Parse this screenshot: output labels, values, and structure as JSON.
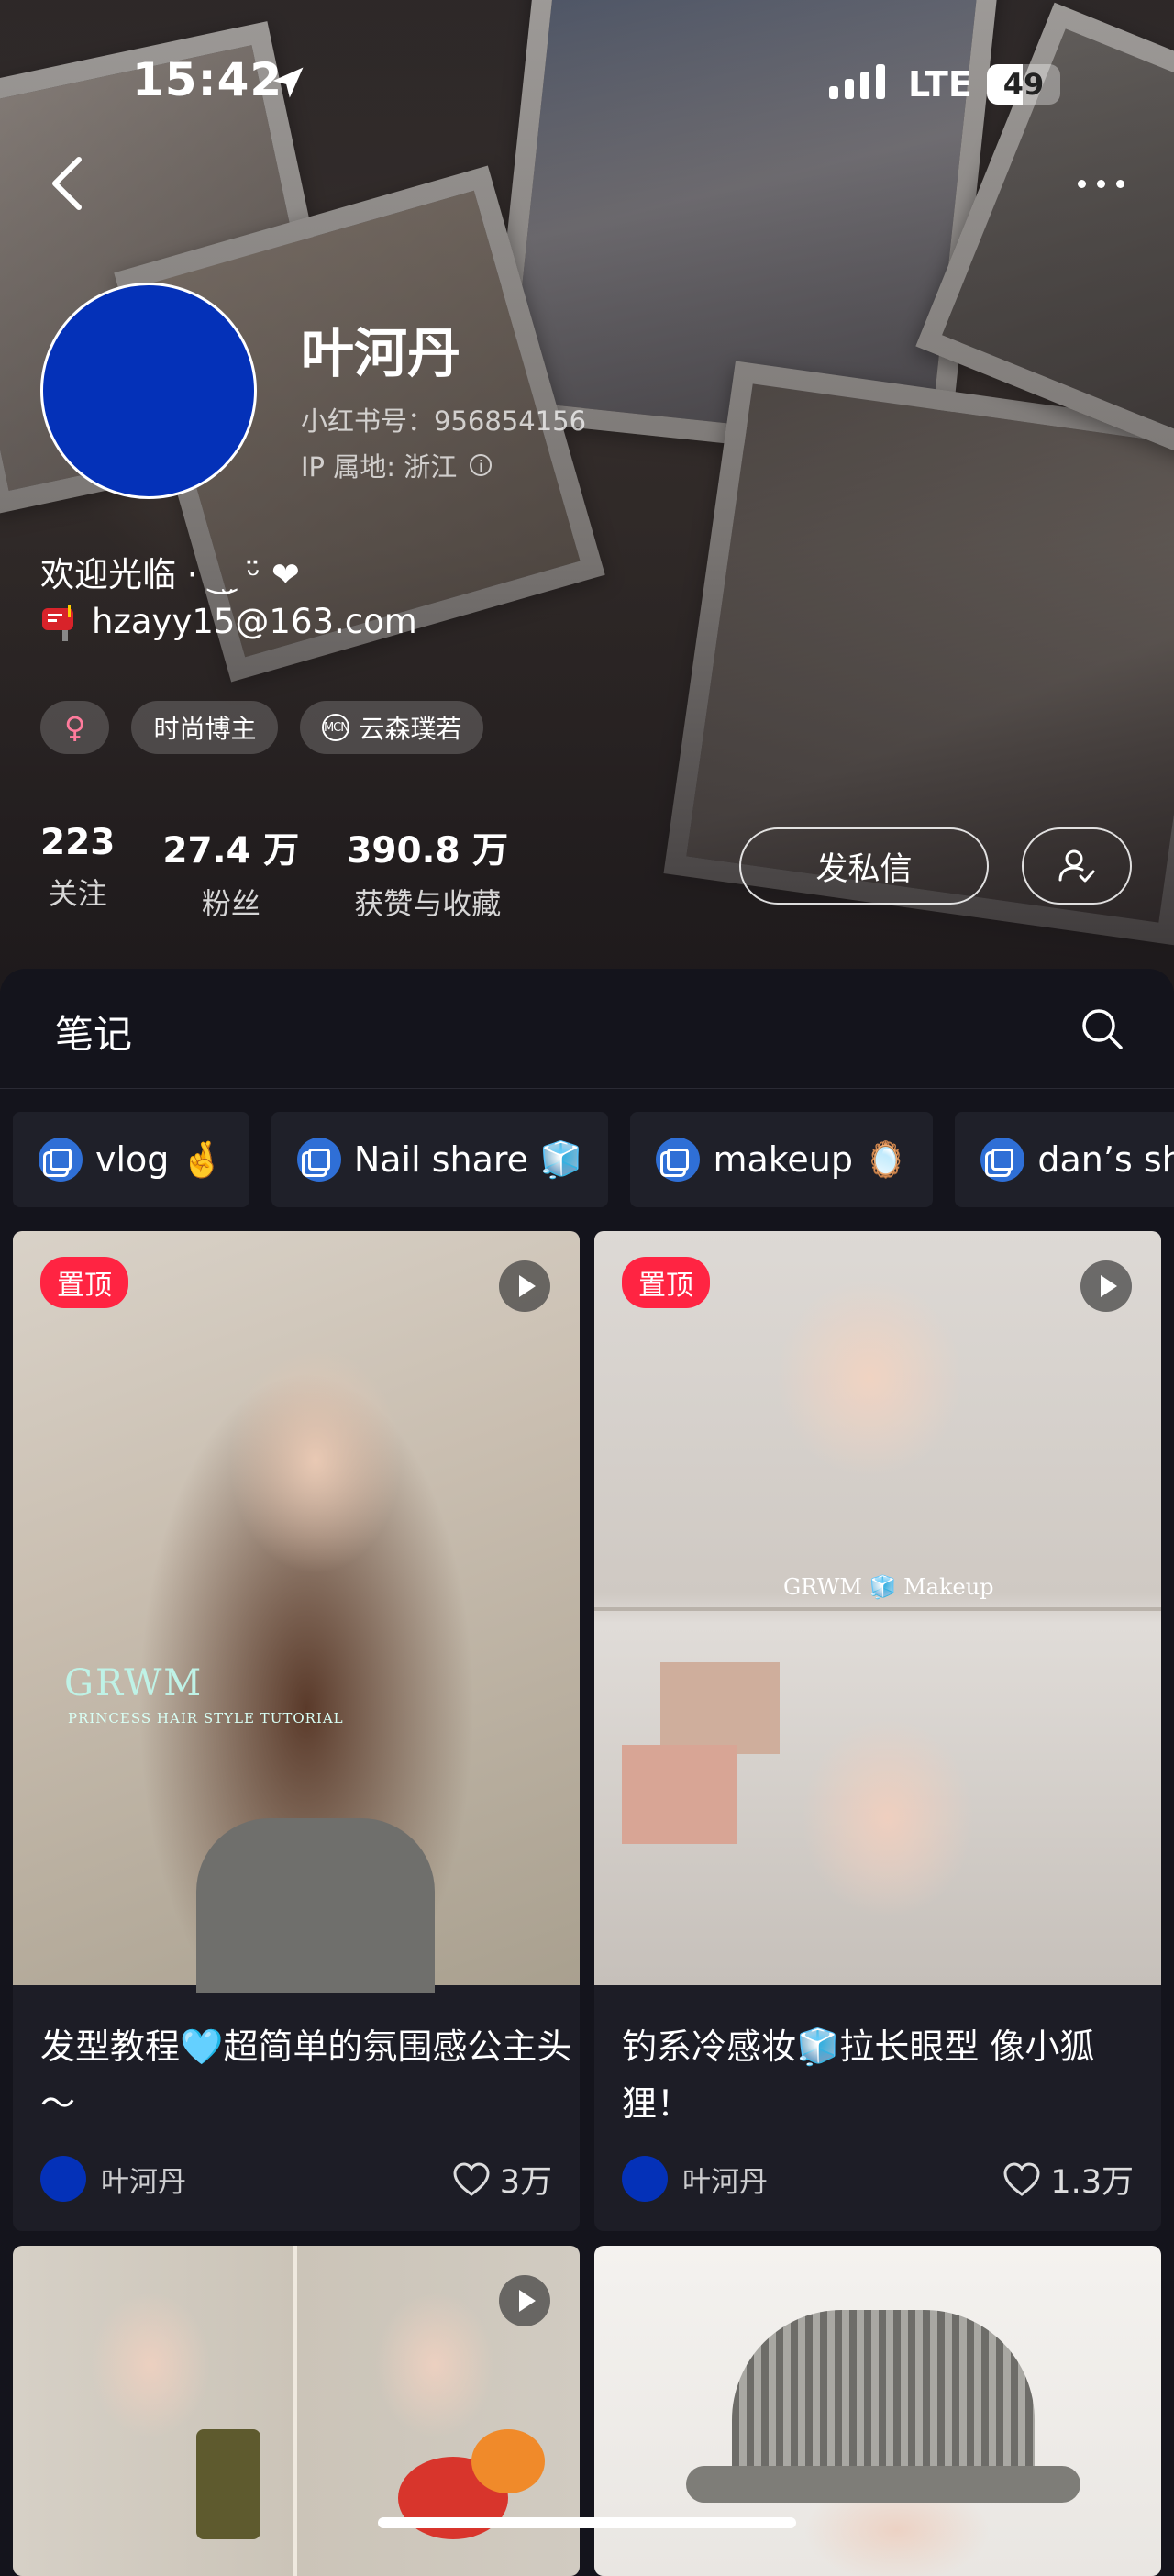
{
  "status_bar": {
    "time": "15:42",
    "network": "LTE",
    "battery": "49",
    "battery_level": 0.49
  },
  "profile": {
    "name": "叶河丹",
    "red_id": "小红书号：956854156",
    "ip_location": "IP 属地: 浙江",
    "avatar_color": "#0431b8",
    "bio_line1": "欢迎光临 · ‿̮ ᵕ̈ ❤",
    "bio_email": "hzayy15@163.com",
    "tags": [
      "♀",
      "时尚博主",
      "云森璞若"
    ],
    "mcn_label": "MCN"
  },
  "stats": [
    {
      "num": "223",
      "label": "关注"
    },
    {
      "num": "27.4 万",
      "label": "粉丝"
    },
    {
      "num": "390.8 万",
      "label": "获赞与收藏"
    }
  ],
  "actions": {
    "message_label": "发私信"
  },
  "notes_header": {
    "tab_label": "笔记"
  },
  "collections": [
    "vlog 🤞",
    "Nail share 🧊",
    "makeup 🪞",
    "dan’s sh"
  ],
  "notes": [
    {
      "pinned": "置顶",
      "title": "发型教程🩵超简单的氛围感公主头～",
      "author": "叶河丹",
      "likes": "3万",
      "overlay": "GRWM",
      "overlay_sub": "PRINCESS HAIR STYLE TUTORIAL"
    },
    {
      "pinned": "置顶",
      "title": "钓系冷感妆🧊拉长眼型 像小狐狸！",
      "author": "叶河丹",
      "likes": "1.3万",
      "overlay": "GRWM 🧊 Makeup"
    }
  ],
  "colors": {
    "accent_red": "#ff2442",
    "background": "#14141c",
    "card": "#1d1d26",
    "collection_icon": "#2f6fd6"
  }
}
